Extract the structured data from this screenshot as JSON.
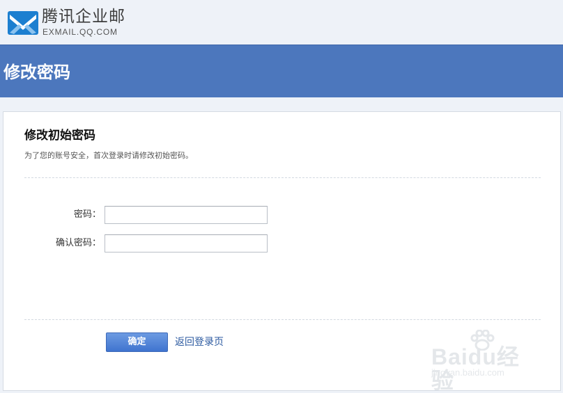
{
  "brand": {
    "name": "腾讯企业邮",
    "domain": "EXMAIL.QQ.COM",
    "color": "#1c7fd0"
  },
  "header": {
    "title": "修改密码",
    "background_color": "#4c77bd"
  },
  "panel": {
    "title": "修改初始密码",
    "description": "为了您的账号安全，首次登录时请修改初始密码。"
  },
  "form": {
    "password_label": "密码：",
    "password_value": "",
    "confirm_label": "确认密码：",
    "confirm_value": ""
  },
  "actions": {
    "confirm_label": "确定",
    "back_link_label": "返回登录页"
  },
  "watermark": {
    "brand_text": "Baidu经验",
    "url_text": "jingyan.baidu.com"
  },
  "icons": {
    "logo": "mail-logo-icon",
    "watermark_paw": "paw-icon"
  }
}
